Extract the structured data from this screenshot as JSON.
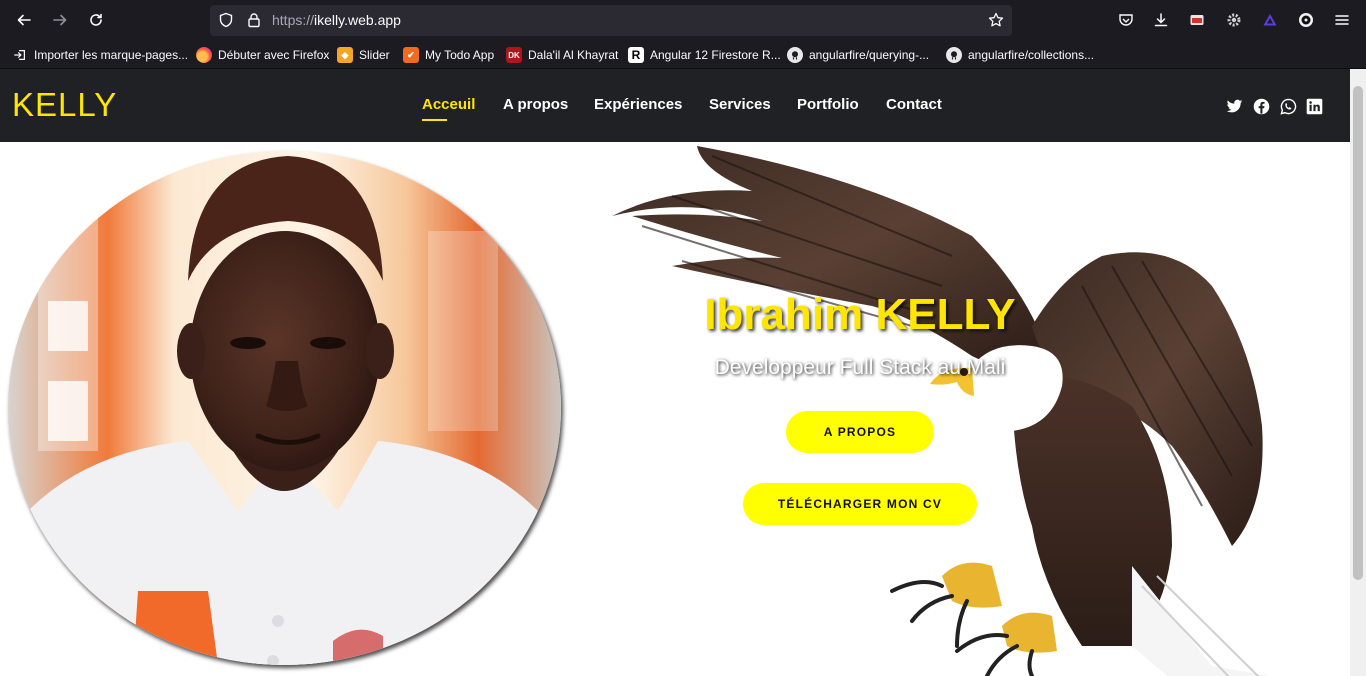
{
  "browser": {
    "url_protocol": "https://",
    "url_host": "ikelly.web.app",
    "bookmarks": [
      {
        "label": "Importer les marque-pages...",
        "icon": "import-icon"
      },
      {
        "label": "Débuter avec Firefox",
        "icon": "firefox-icon"
      },
      {
        "label": "Slider",
        "icon": "slider-bookmark-icon"
      },
      {
        "label": "My Todo App",
        "icon": "todo-app-icon"
      },
      {
        "label": "Dala'il Al Khayrat",
        "icon": "dalail-icon"
      },
      {
        "label": "Angular 12 Firestore R...",
        "icon": "angular-r-icon"
      },
      {
        "label": "angularfire/querying-...",
        "icon": "github-icon"
      },
      {
        "label": "angularfire/collections...",
        "icon": "github-icon"
      }
    ]
  },
  "site": {
    "logo": "KELLY",
    "menu": [
      "Acceuil",
      "A propos",
      "Expériences",
      "Services",
      "Portfolio",
      "Contact"
    ],
    "active_menu": "Acceuil",
    "social": [
      "twitter-icon",
      "facebook-icon",
      "whatsapp-icon",
      "linkedin-icon"
    ],
    "accent_color": "#ffe600",
    "header_bg": "#202124"
  },
  "hero": {
    "name": "Ibrahim KELLY",
    "subtitle": "Developpeur Full Stack au Mali",
    "about_button": "A PROPOS",
    "cv_button": "TÉLÉCHARGER MON CV",
    "button_color": "#ffff00"
  }
}
